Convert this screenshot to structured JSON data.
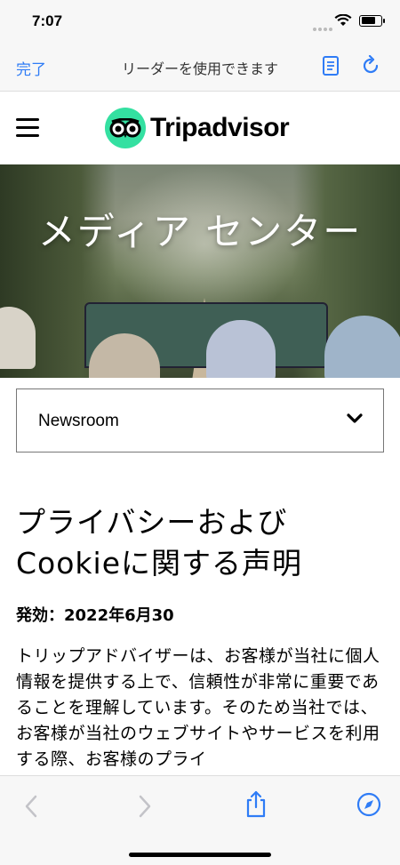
{
  "status": {
    "time": "7:07"
  },
  "safari": {
    "done_label": "完了",
    "reader_message": "リーダーを使用できます",
    "icons": [
      "reader-icon",
      "reload-icon"
    ]
  },
  "site": {
    "logo_text": "Tripadvisor",
    "brand_color": "#34e0a1",
    "hero_title": "メディア センター",
    "newsroom_selected": "Newsroom"
  },
  "article": {
    "title": "プライバシーおよびCookieに関する声明",
    "effective": "発効：2022年6月30",
    "body": "トリップアドバイザーは、お客様が当社に個人情報を提供する上で、信頼性が非常に重要であることを理解しています。そのため当社では、お客様が当社のウェブサイトやサービスを利用する際、お客様のプライ"
  },
  "toolbar": {
    "icons": [
      "back-icon",
      "forward-icon",
      "share-icon",
      "compass-icon"
    ],
    "accent_color": "#2f7cf6"
  }
}
